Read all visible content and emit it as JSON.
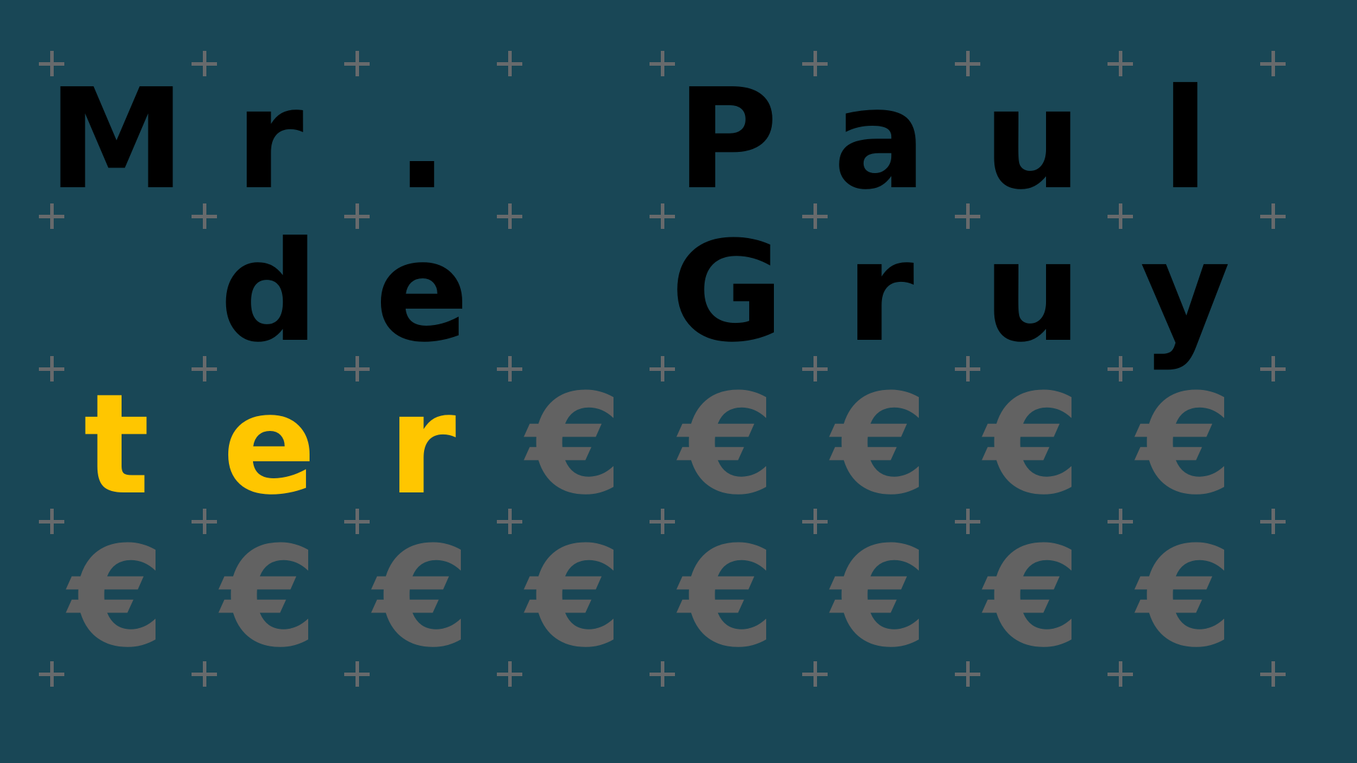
{
  "game": {
    "type": "word-puzzle-grid",
    "colors": {
      "background": "#194756",
      "filled_letter": "#000000",
      "typed_letter": "#ffc600",
      "empty_slot": "#626262",
      "grid_marker": "#676a6c"
    },
    "empty_glyph": "€",
    "grid_marker_glyph": "+",
    "rows": [
      {
        "cells": [
          {
            "char": "M",
            "state": "filled"
          },
          {
            "char": "r",
            "state": "filled"
          },
          {
            "char": ".",
            "state": "filled"
          },
          {
            "char": "",
            "state": "blank"
          },
          {
            "char": "P",
            "state": "filled"
          },
          {
            "char": "a",
            "state": "filled"
          },
          {
            "char": "u",
            "state": "filled"
          },
          {
            "char": "l",
            "state": "filled"
          }
        ]
      },
      {
        "cells": [
          {
            "char": "",
            "state": "blank"
          },
          {
            "char": "d",
            "state": "filled"
          },
          {
            "char": "e",
            "state": "filled"
          },
          {
            "char": "",
            "state": "blank"
          },
          {
            "char": "G",
            "state": "filled"
          },
          {
            "char": "r",
            "state": "filled"
          },
          {
            "char": "u",
            "state": "filled"
          },
          {
            "char": "y",
            "state": "filled"
          }
        ]
      },
      {
        "cells": [
          {
            "char": "t",
            "state": "typed"
          },
          {
            "char": "e",
            "state": "typed"
          },
          {
            "char": "r",
            "state": "typed"
          },
          {
            "char": "€",
            "state": "empty"
          },
          {
            "char": "€",
            "state": "empty"
          },
          {
            "char": "€",
            "state": "empty"
          },
          {
            "char": "€",
            "state": "empty"
          },
          {
            "char": "€",
            "state": "empty"
          }
        ]
      },
      {
        "cells": [
          {
            "char": "€",
            "state": "empty"
          },
          {
            "char": "€",
            "state": "empty"
          },
          {
            "char": "€",
            "state": "empty"
          },
          {
            "char": "€",
            "state": "empty"
          },
          {
            "char": "€",
            "state": "empty"
          },
          {
            "char": "€",
            "state": "empty"
          },
          {
            "char": "€",
            "state": "empty"
          },
          {
            "char": "€",
            "state": "empty"
          }
        ]
      }
    ]
  }
}
